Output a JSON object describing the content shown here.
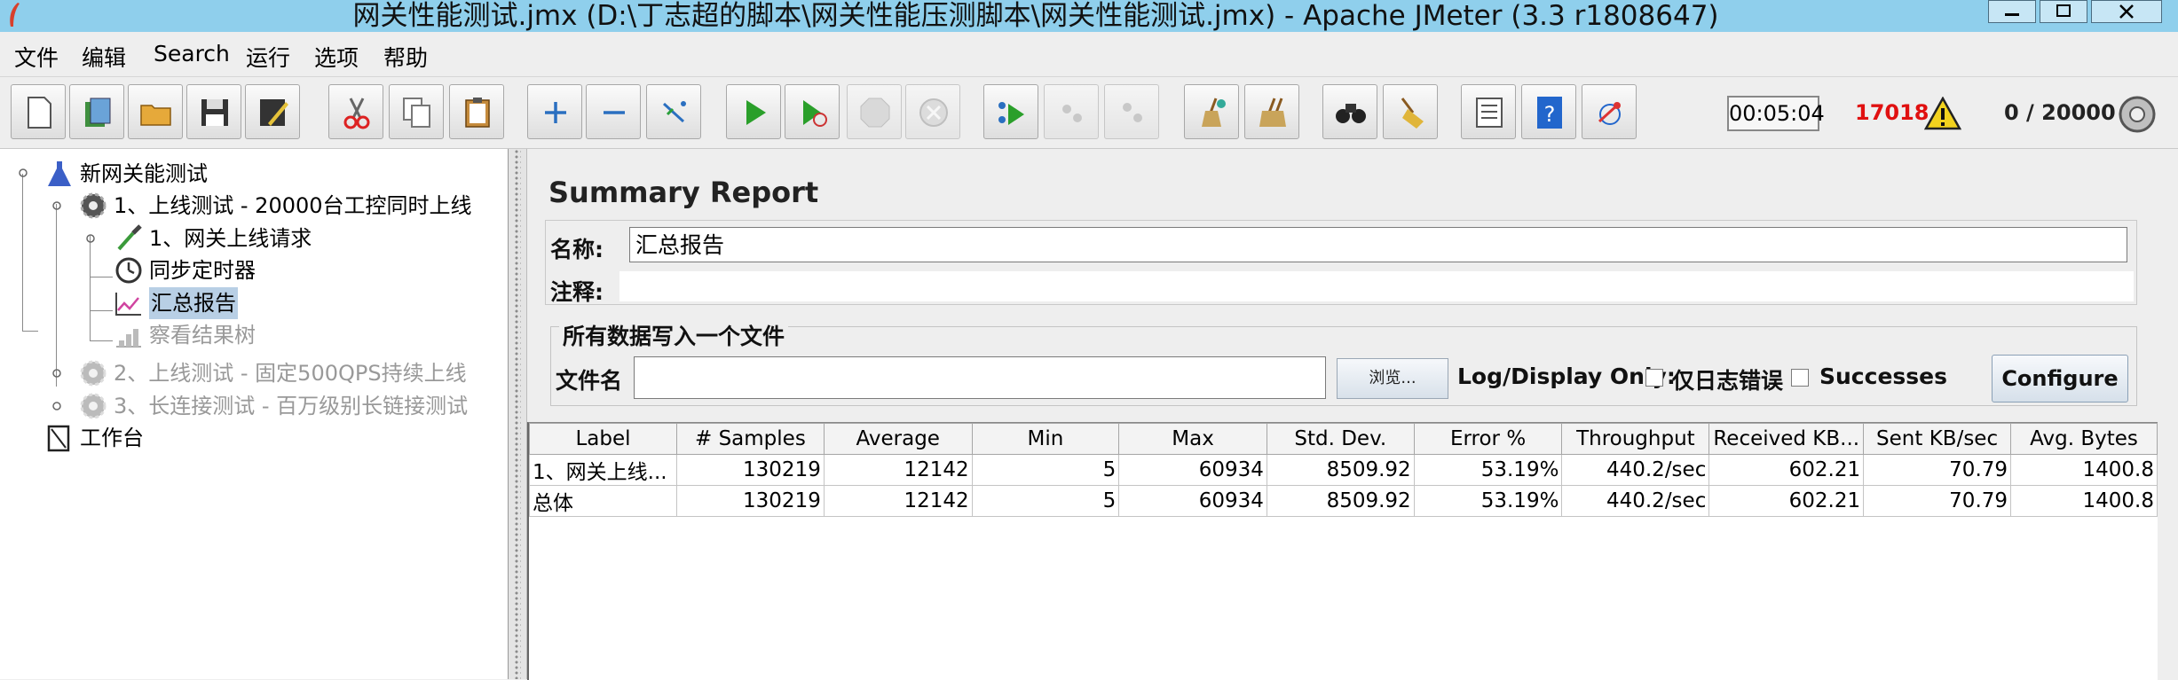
{
  "window": {
    "title": "网关性能测试.jmx (D:\\丁志超的脚本\\网关性能压测脚本\\网关性能测试.jmx) - Apache JMeter (3.3 r1808647)"
  },
  "menu": [
    "文件",
    "编辑",
    "Search",
    "运行",
    "选项",
    "帮助"
  ],
  "toolbar": {
    "buttons": [
      "new",
      "templates",
      "open",
      "save",
      "save-as",
      "cut",
      "copy",
      "paste",
      "expand",
      "collapse",
      "toggle",
      "start",
      "start-no-pauses",
      "stop",
      "shutdown",
      "remote-start",
      "remote-stop",
      "remote-shutdown",
      "clear",
      "clear-all",
      "search",
      "reset-search",
      "function-helper",
      "help",
      "log-viewer"
    ],
    "elapsed_time": "00:05:04",
    "error_count": "17018",
    "threads": "0 / 20000"
  },
  "tree": {
    "items": [
      {
        "label": "新网关能测试",
        "icon": "flask-icon",
        "state": "enabled"
      },
      {
        "label": "1、上线测试 - 20000台工控同时上线",
        "icon": "gear-icon",
        "state": "enabled"
      },
      {
        "label": "1、网关上线请求",
        "icon": "pipette-icon",
        "state": "enabled"
      },
      {
        "label": "同步定时器",
        "icon": "timer-icon",
        "state": "enabled"
      },
      {
        "label": "汇总报告",
        "icon": "graph-icon",
        "state": "selected"
      },
      {
        "label": "察看结果树",
        "icon": "graph-icon",
        "state": "disabled"
      },
      {
        "label": "2、上线测试 - 固定500QPS持续上线",
        "icon": "gear-icon",
        "state": "disabled"
      },
      {
        "label": "3、长连接测试 - 百万级别长链接测试",
        "icon": "gear-icon",
        "state": "disabled"
      },
      {
        "label": "工作台",
        "icon": "notebook-icon",
        "state": "enabled"
      }
    ]
  },
  "panel": {
    "title": "Summary Report",
    "name_label": "名称:",
    "name_value": "汇总报告",
    "comment_label": "注释:",
    "file_group_title": "所有数据写入一个文件",
    "filename_label": "文件名",
    "browse_label": "浏览...",
    "log_display_label": "Log/Display Only:",
    "errors_only_label": "仅日志错误",
    "successes_label": "Successes",
    "configure_label": "Configure"
  },
  "table": {
    "columns": [
      "Label",
      "# Samples",
      "Average",
      "Min",
      "Max",
      "Std. Dev.",
      "Error %",
      "Throughput",
      "Received KB...",
      "Sent KB/sec",
      "Avg. Bytes"
    ],
    "rows": [
      [
        "1、网关上线...",
        "130219",
        "12142",
        "5",
        "60934",
        "8509.92",
        "53.19%",
        "440.2/sec",
        "602.21",
        "70.79",
        "1400.8"
      ],
      [
        "总体",
        "130219",
        "12142",
        "5",
        "60934",
        "8509.92",
        "53.19%",
        "440.2/sec",
        "602.21",
        "70.79",
        "1400.8"
      ]
    ]
  }
}
